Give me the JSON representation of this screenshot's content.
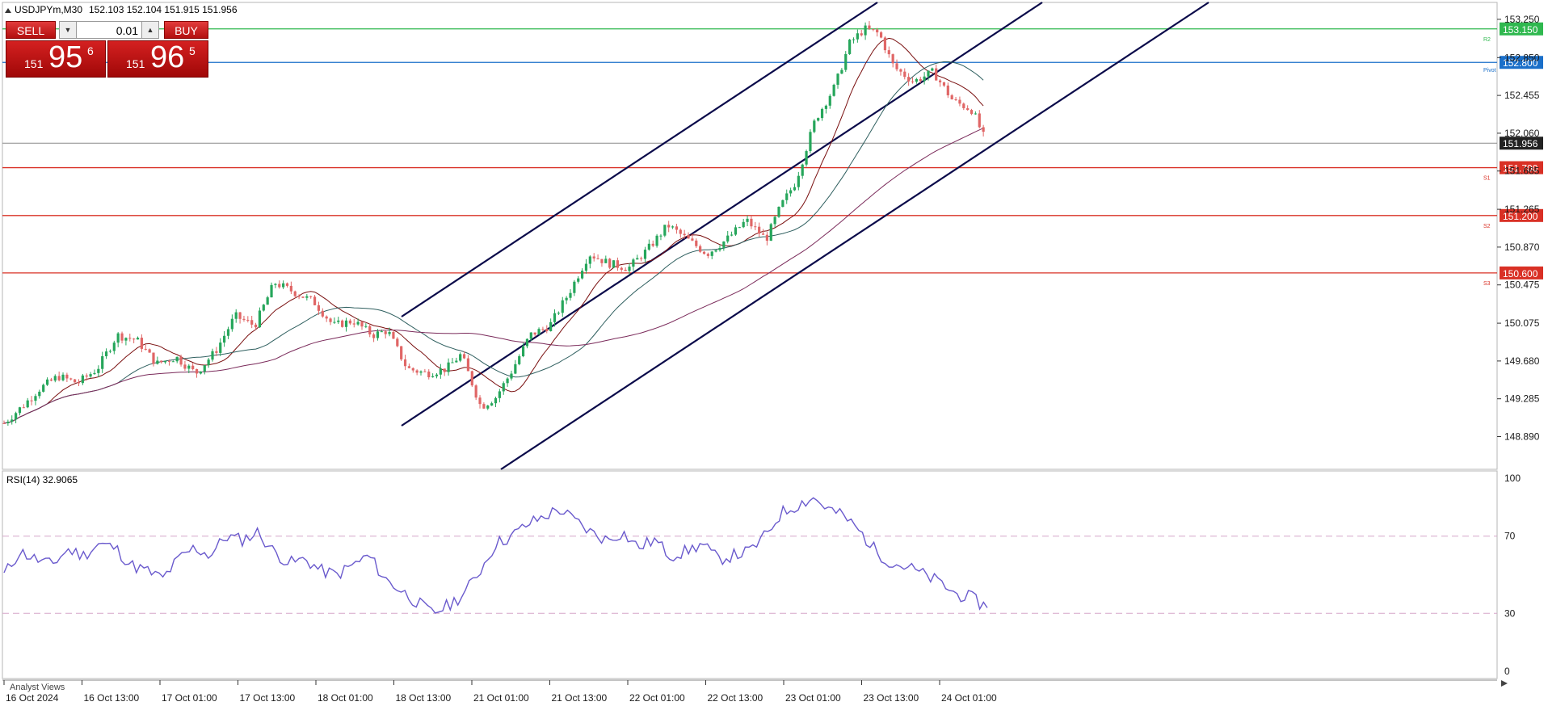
{
  "header": {
    "symbol_label": "USDJPYm,M30",
    "ohlc": "152.103 152.104 151.915 151.956"
  },
  "trade_panel": {
    "sell_label": "SELL",
    "buy_label": "BUY",
    "lot_value": "0.01",
    "sell_prefix": "151",
    "sell_big": "95",
    "sell_sup": "6",
    "buy_prefix": "151",
    "buy_big": "96",
    "buy_sup": "5",
    "sell_color": "#c4151c",
    "buy_color": "#c4151c"
  },
  "bottom_label": "Analyst Views",
  "chart_data": [
    {
      "type": "candlestick",
      "timeframe": "M30",
      "ylim": [
        148.7,
        153.3
      ],
      "y_ticks": [
        "153.250",
        "152.850",
        "152.455",
        "152.060",
        "151.665",
        "151.265",
        "150.870",
        "150.475",
        "150.075",
        "149.680",
        "149.285",
        "148.890"
      ],
      "x_ticks": [
        "16 Oct 2024",
        "16 Oct 13:00",
        "17 Oct 01:00",
        "17 Oct 13:00",
        "18 Oct 01:00",
        "18 Oct 13:00",
        "21 Oct 01:00",
        "21 Oct 13:00",
        "22 Oct 01:00",
        "22 Oct 13:00",
        "23 Oct 01:00",
        "23 Oct 13:00",
        "24 Oct 01:00"
      ],
      "current_price": 151.956,
      "current_price_label": "151.956",
      "levels": [
        {
          "name": "R2",
          "value": 153.15,
          "label": "153.150",
          "color": "#2fb84f"
        },
        {
          "name": "Pivot",
          "value": 152.8,
          "label": "152.800",
          "color": "#1a6fc9"
        },
        {
          "name": "S1",
          "value": 151.7,
          "label": "151.700",
          "color": "#d93025"
        },
        {
          "name": "S2",
          "value": 151.2,
          "label": "151.200",
          "color": "#d93025"
        },
        {
          "name": "S3",
          "value": 150.6,
          "label": "150.600",
          "color": "#d93025"
        }
      ],
      "price_path": [
        [
          0,
          149.03
        ],
        [
          8,
          149.22
        ],
        [
          14,
          149.38
        ],
        [
          22,
          149.52
        ],
        [
          30,
          149.45
        ],
        [
          38,
          149.6
        ],
        [
          46,
          149.95
        ],
        [
          54,
          149.9
        ],
        [
          62,
          149.65
        ],
        [
          70,
          149.72
        ],
        [
          78,
          149.55
        ],
        [
          86,
          149.78
        ],
        [
          94,
          150.15
        ],
        [
          102,
          150.05
        ],
        [
          110,
          150.5
        ],
        [
          118,
          150.4
        ],
        [
          126,
          150.3
        ],
        [
          134,
          150.05
        ],
        [
          142,
          150.1
        ],
        [
          150,
          149.95
        ],
        [
          156,
          150.0
        ],
        [
          164,
          149.6
        ],
        [
          172,
          149.55
        ],
        [
          180,
          149.6
        ],
        [
          186,
          149.75
        ],
        [
          194,
          149.2
        ],
        [
          200,
          149.3
        ],
        [
          206,
          149.55
        ],
        [
          214,
          149.95
        ],
        [
          222,
          150.05
        ],
        [
          230,
          150.4
        ],
        [
          238,
          150.8
        ],
        [
          246,
          150.7
        ],
        [
          254,
          150.65
        ],
        [
          262,
          150.85
        ],
        [
          270,
          151.1
        ],
        [
          278,
          150.95
        ],
        [
          286,
          150.8
        ],
        [
          294,
          150.95
        ],
        [
          302,
          151.15
        ],
        [
          310,
          150.95
        ],
        [
          316,
          151.3
        ],
        [
          322,
          151.55
        ],
        [
          330,
          152.2
        ],
        [
          338,
          152.55
        ],
        [
          344,
          153.0
        ],
        [
          350,
          153.15
        ],
        [
          356,
          153.1
        ],
        [
          362,
          152.75
        ],
        [
          370,
          152.6
        ],
        [
          378,
          152.7
        ],
        [
          386,
          152.4
        ],
        [
          394,
          152.3
        ],
        [
          398,
          152.05
        ],
        [
          400,
          151.956
        ]
      ],
      "lines": [
        {
          "name": "channel-upper",
          "from": [
            "18 Oct 13:00",
            150.6
          ],
          "to": [
            "23 Oct 13:00",
            153.3
          ],
          "color": "#0a0a4a"
        },
        {
          "name": "channel-middle",
          "from": [
            "18 Oct 13:00",
            149.2
          ],
          "to": [
            "24 Oct 13:00",
            153.3
          ],
          "color": "#0a0a4a"
        },
        {
          "name": "channel-lower",
          "from": [
            "18 Oct 13:00",
            148.7
          ],
          "to": [
            "24 Oct 13:00",
            153.3
          ],
          "color": "#0a0a4a"
        }
      ]
    },
    {
      "type": "line",
      "title": "RSI(14) 32.9065",
      "ylim": [
        0,
        100
      ],
      "y_ticks": [
        "100",
        "70",
        "30",
        "0"
      ],
      "levels": [
        70,
        30
      ],
      "series": [
        {
          "name": "RSI(14)",
          "color": "#6a5acd",
          "values": [
            50,
            62,
            58,
            55,
            63,
            60,
            66,
            64,
            55,
            52,
            48,
            58,
            64,
            60,
            70,
            68,
            72,
            62,
            56,
            58,
            52,
            50,
            55,
            60,
            48,
            42,
            36,
            30,
            34,
            40,
            52,
            66,
            70,
            76,
            80,
            84,
            78,
            72,
            68,
            72,
            64,
            68,
            60,
            62,
            66,
            58,
            60,
            62,
            70,
            82,
            86,
            90,
            84,
            80,
            72,
            62,
            56,
            54,
            50,
            46,
            40,
            38,
            32.9065
          ]
        }
      ]
    }
  ]
}
